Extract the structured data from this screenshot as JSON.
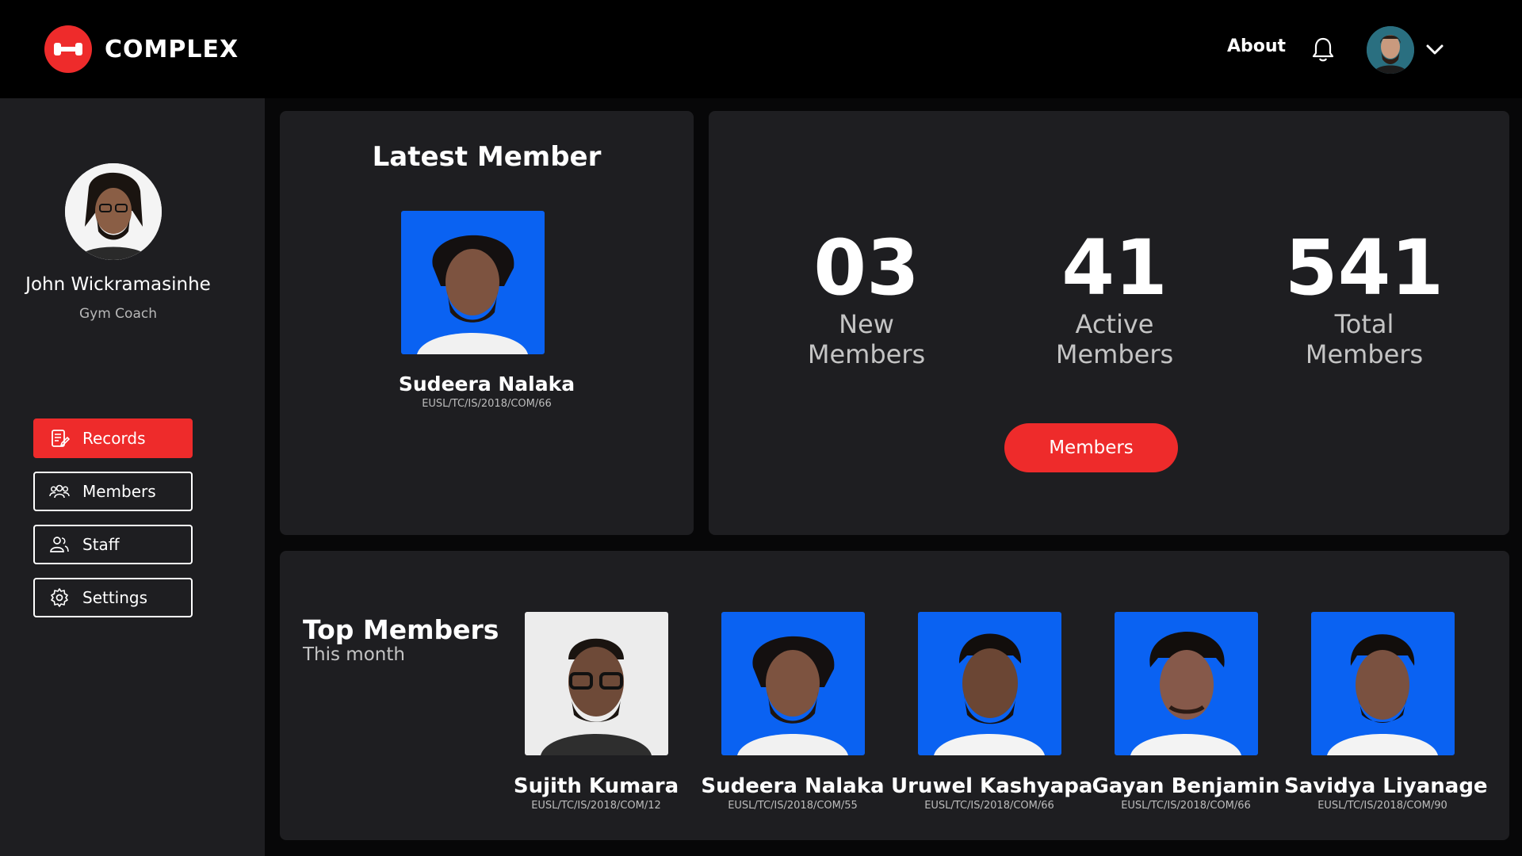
{
  "header": {
    "brand": "COMPLEX",
    "about_label": "About"
  },
  "colors": {
    "accent": "#ee2b2b",
    "card": "#1e1e21",
    "photo_bg": "#0a62f2"
  },
  "sidebar": {
    "user_name": "John Wickramasinhe",
    "user_role": "Gym Coach",
    "items": [
      {
        "label": "Records",
        "icon": "records-icon",
        "active": true
      },
      {
        "label": "Members",
        "icon": "members-icon",
        "active": false
      },
      {
        "label": "Staff",
        "icon": "staff-icon",
        "active": false
      },
      {
        "label": "Settings",
        "icon": "gear-icon",
        "active": false
      }
    ]
  },
  "latest": {
    "title": "Latest Member",
    "name": "Sudeera Nalaka",
    "id": "EUSL/TC/IS/2018/COM/66"
  },
  "stats": [
    {
      "value": "03",
      "label_line1": "New",
      "label_line2": "Members"
    },
    {
      "value": "41",
      "label_line1": "Active",
      "label_line2": "Members"
    },
    {
      "value": "541",
      "label_line1": "Total",
      "label_line2": "Members"
    }
  ],
  "members_button_label": "Members",
  "top_members": {
    "title": "Top Members",
    "subtitle": "This month",
    "list": [
      {
        "name": "Sujith Kumara",
        "id": "EUSL/TC/IS/2018/COM/12"
      },
      {
        "name": "Sudeera Nalaka",
        "id": "EUSL/TC/IS/2018/COM/55"
      },
      {
        "name": "Uruwel Kashyapa",
        "id": "EUSL/TC/IS/2018/COM/66"
      },
      {
        "name": "Gayan Benjamin",
        "id": "EUSL/TC/IS/2018/COM/66"
      },
      {
        "name": "Savidya Liyanage",
        "id": "EUSL/TC/IS/2018/COM/90"
      }
    ]
  }
}
